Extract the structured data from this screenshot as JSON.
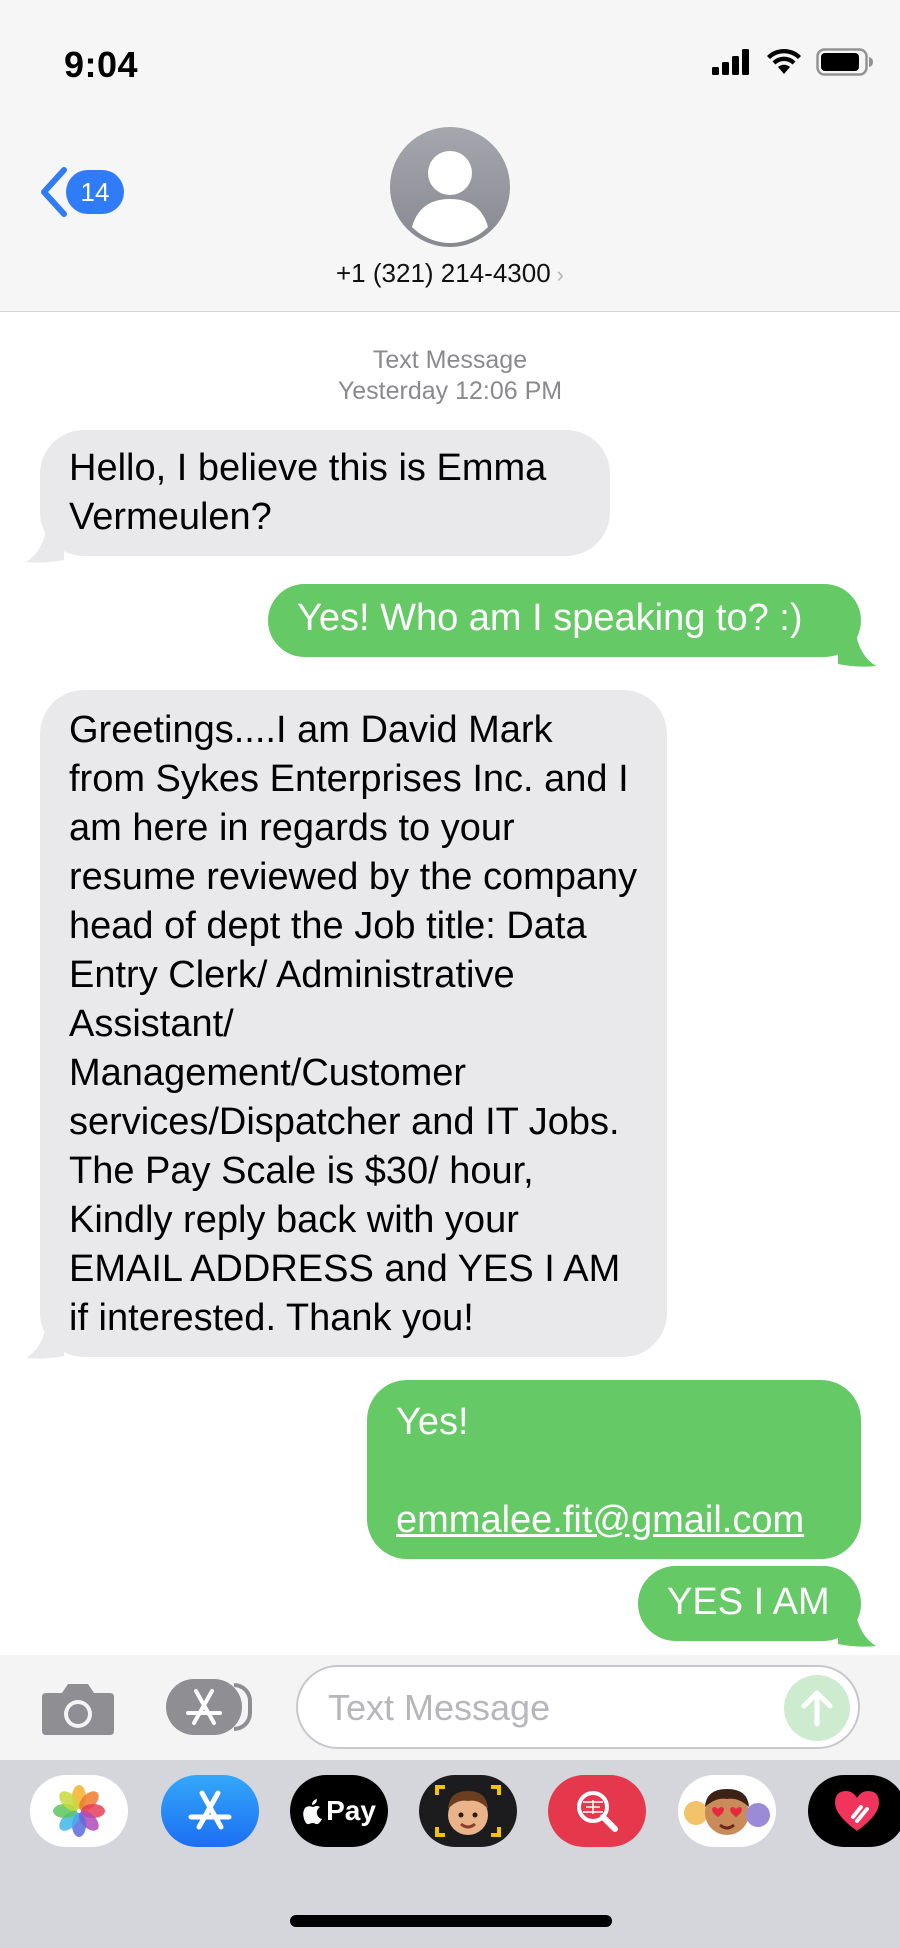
{
  "status_bar": {
    "time": "9:04"
  },
  "header": {
    "back_count": "14",
    "contact_number": "+1 (321) 214-4300",
    "contact_chevron": "›"
  },
  "conversation": {
    "meta_type": "Text Message",
    "meta_time": "Yesterday 12:06 PM",
    "messages": [
      {
        "direction": "received",
        "text": "Hello, I believe this is Emma Vermeulen?"
      },
      {
        "direction": "sent",
        "text": "Yes! Who am I speaking to? :)"
      },
      {
        "direction": "received",
        "text": "Greetings....I am David Mark from Sykes Enterprises Inc. and I am here in regards to your resume reviewed by the company head of dept the Job title: Data Entry Clerk/ Administrative Assistant/ Management/Customer services/Dispatcher and IT Jobs. The Pay Scale is $30/ hour, Kindly reply back with your EMAIL ADDRESS and YES I AM if interested. Thank you!"
      },
      {
        "direction": "sent",
        "text": "Yes!",
        "link": "emmalee.fit@gmail.com"
      },
      {
        "direction": "sent",
        "text": "YES I AM"
      }
    ]
  },
  "composer": {
    "placeholder": "Text Message",
    "camera_icon": "camera-icon",
    "apps_icon": "app-store-icon",
    "send_icon": "arrow-up-icon"
  },
  "app_drawer": {
    "apps": [
      "photos-app",
      "app-store-app",
      "apple-pay-app",
      "memoji-app",
      "search-images-app",
      "memoji-stickers-app",
      "digital-touch-app"
    ],
    "apple_pay_label": "Pay"
  },
  "colors": {
    "sent_bubble": "#65c966",
    "received_bubble": "#e9e9eb",
    "accent_blue": "#2f7cf6",
    "header_bg": "#f6f6f6"
  }
}
